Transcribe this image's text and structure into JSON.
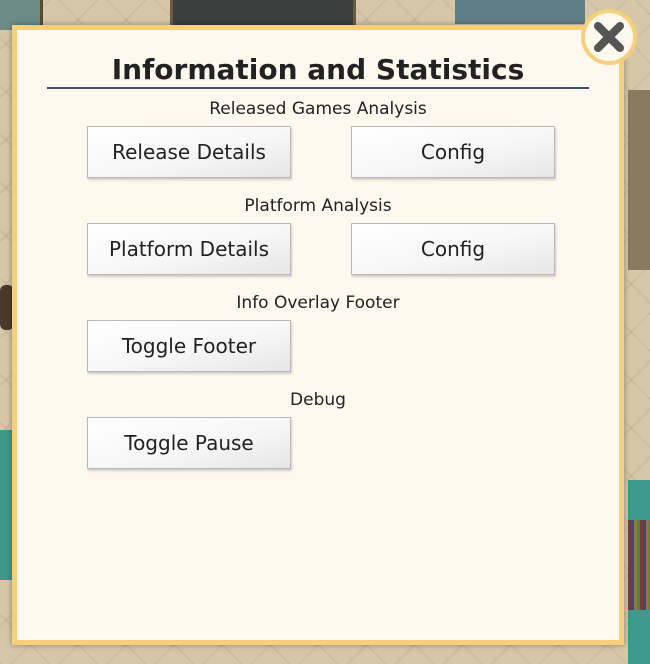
{
  "dialog": {
    "title": "Information and Statistics",
    "sections": [
      {
        "label": "Released Games Analysis",
        "buttons": [
          "Release Details",
          "Config"
        ]
      },
      {
        "label": "Platform Analysis",
        "buttons": [
          "Platform Details",
          "Config"
        ]
      },
      {
        "label": "Info Overlay Footer",
        "buttons": [
          "Toggle Footer"
        ]
      },
      {
        "label": "Debug",
        "buttons": [
          "Toggle Pause"
        ]
      }
    ]
  },
  "icons": {
    "close": "close-icon"
  },
  "colors": {
    "panel_background": "#fff8ee",
    "panel_border": "#f5cf7c",
    "title_rule": "#3d4f6e",
    "close_x": "#555555"
  }
}
